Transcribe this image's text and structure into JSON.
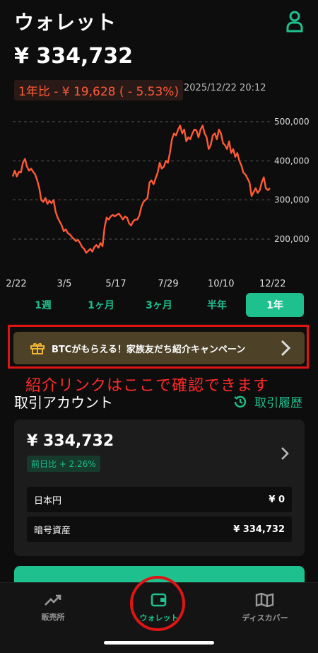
{
  "header": {
    "title": "ウォレット",
    "user_icon": "user-icon"
  },
  "balance": "¥ 334,732",
  "change": {
    "text": "1年比 - ¥ 19,628 ( - 5.53%)",
    "color": "#ff5a36"
  },
  "timestamp": "2025/12/22 20:12",
  "chart_data": {
    "type": "line",
    "x_ticks": [
      "2/22",
      "3/5",
      "5/17",
      "7/29",
      "10/10",
      "12/22"
    ],
    "y_ticks": [
      "500,000",
      "400,000",
      "300,000",
      "200,000"
    ],
    "ylim": [
      150000,
      520000
    ],
    "grid": true,
    "color": "#ff5a36",
    "values": [
      360000,
      375000,
      360000,
      372000,
      370000,
      395000,
      405000,
      385000,
      375000,
      380000,
      372000,
      365000,
      350000,
      330000,
      300000,
      295000,
      305000,
      290000,
      298000,
      292000,
      300000,
      270000,
      255000,
      245000,
      235000,
      220000,
      225000,
      215000,
      212000,
      205000,
      200000,
      195000,
      198000,
      190000,
      180000,
      175000,
      165000,
      170000,
      175000,
      168000,
      180000,
      185000,
      178000,
      190000,
      182000,
      230000,
      255000,
      250000,
      258000,
      262000,
      258000,
      262000,
      265000,
      258000,
      250000,
      258000,
      255000,
      240000,
      235000,
      245000,
      250000,
      250000,
      260000,
      282000,
      295000,
      300000,
      305000,
      345000,
      350000,
      340000,
      355000,
      370000,
      395000,
      380000,
      385000,
      400000,
      395000,
      420000,
      455000,
      470000,
      465000,
      480000,
      490000,
      470000,
      480000,
      450000,
      460000,
      455000,
      470000,
      480000,
      478000,
      460000,
      480000,
      490000,
      470000,
      460000,
      430000,
      440000,
      465000,
      470000,
      455000,
      480000,
      470000,
      445000,
      440000,
      430000,
      450000,
      420000,
      430000,
      410000,
      420000,
      400000,
      388000,
      370000,
      365000,
      355000,
      345000,
      310000,
      320000,
      330000,
      318000,
      325000,
      345000,
      358000,
      330000,
      325000,
      330000
    ],
    "y_at_500000": 500000
  },
  "periods": [
    {
      "label": "1週",
      "active": false
    },
    {
      "label": "1ヶ月",
      "active": false
    },
    {
      "label": "3ヶ月",
      "active": false
    },
    {
      "label": "半年",
      "active": false
    },
    {
      "label": "1年",
      "active": true
    }
  ],
  "promo": {
    "text": "BTCがもらえる！家族友だち紹介キャンペーン",
    "icon": "gift-icon"
  },
  "annotation": "紹介リンクはここで確認できます",
  "account": {
    "title": "取引アカウント",
    "history_label": "取引履歴",
    "balance": "¥ 334,732",
    "daily_change": "前日比 + 2.26%",
    "rows": [
      {
        "label": "日本円",
        "value": "¥ 0"
      },
      {
        "label": "暗号資産",
        "value": "¥ 334,732"
      }
    ]
  },
  "tabs": [
    {
      "label": "販売所",
      "icon": "trending-up-icon",
      "active": false
    },
    {
      "label": "ウォレット",
      "icon": "wallet-icon",
      "active": true
    },
    {
      "label": "ディスカバー",
      "icon": "map-icon",
      "active": false
    }
  ],
  "colors": {
    "accent": "#1ec08e",
    "negative": "#ff5a36",
    "highlight": "#e01414"
  }
}
